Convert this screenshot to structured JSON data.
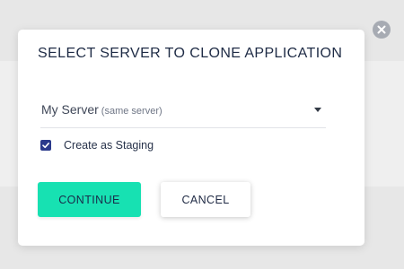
{
  "dialog": {
    "title": "SELECT SERVER TO CLONE APPLICATION",
    "server_select": {
      "value": "My Server",
      "hint": "(same server)"
    },
    "staging_checkbox": {
      "label": "Create as Staging",
      "checked": true
    },
    "continue_label": "CONTINUE",
    "cancel_label": "CANCEL"
  },
  "icons": {
    "close": "close-icon",
    "dropdown": "caret-down-icon",
    "check": "checkmark-icon"
  },
  "colors": {
    "primary_button": "#17e1b2",
    "checkbox_fill": "#2b3a8c",
    "title_text": "#1e2b45",
    "close_button": "#a7abb3"
  }
}
